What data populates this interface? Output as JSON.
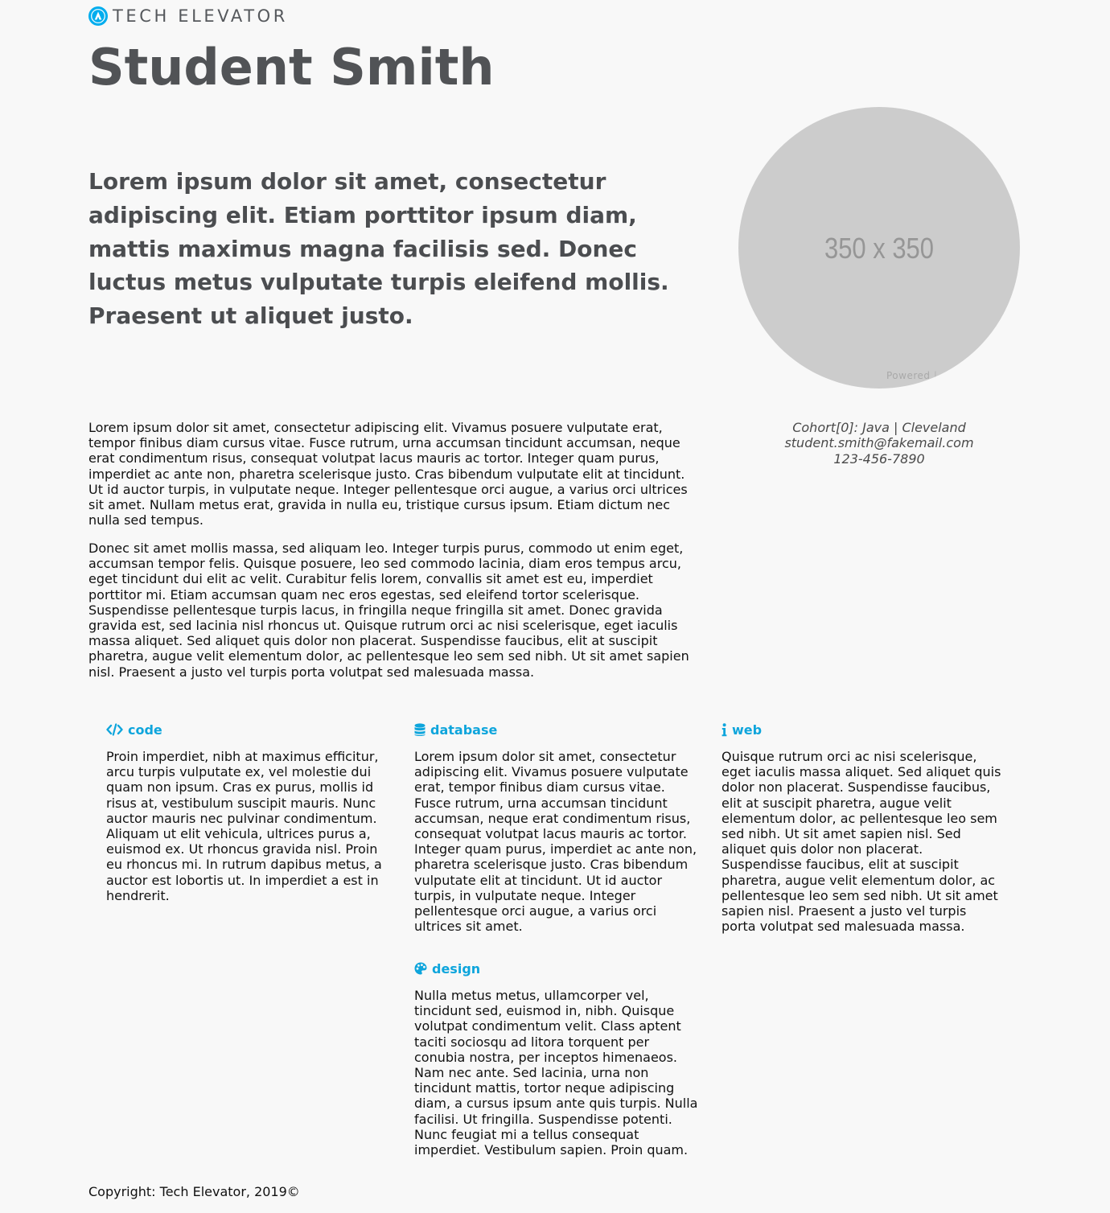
{
  "brand": {
    "logo_text": "TECH ELEVATOR",
    "logo_icon": "tech-elevator-logo-icon",
    "accent_color": "#00adee"
  },
  "profile": {
    "name": "Student Smith",
    "lede": "Lorem ipsum dolor sit amet, consectetur adipiscing elit. Etiam porttitor ipsum diam, mattis maximus magna facilisis sed. Donec luctus metus vulputate turpis eleifend mollis. Praesent ut aliquet justo.",
    "avatar_placeholder": "350 x 350",
    "avatar_powered": "Powered",
    "cohort": "Cohort[0]: Java | Cleveland",
    "email": "student.smith@fakemail.com",
    "phone": "123-456-7890"
  },
  "bio": {
    "paragraphs": [
      "Lorem ipsum dolor sit amet, consectetur adipiscing elit. Vivamus posuere vulputate erat, tempor finibus diam cursus vitae. Fusce rutrum, urna accumsan tincidunt accumsan, neque erat condimentum risus, consequat volutpat lacus mauris ac tortor. Integer quam purus, imperdiet ac ante non, pharetra scelerisque justo. Cras bibendum vulputate elit at tincidunt. Ut id auctor turpis, in vulputate neque. Integer pellentesque orci augue, a varius orci ultrices sit amet. Nullam metus erat, gravida in nulla eu, tristique cursus ipsum. Etiam dictum nec nulla sed tempus.",
      "Donec sit amet mollis massa, sed aliquam leo. Integer turpis purus, commodo ut enim eget, accumsan tempor felis. Quisque posuere, leo sed commodo lacinia, diam eros tempus arcu, eget tincidunt dui elit ac velit. Curabitur felis lorem, convallis sit amet est eu, imperdiet porttitor mi. Etiam accumsan quam nec eros egestas, sed eleifend tortor scelerisque. Suspendisse pellentesque turpis lacus, in fringilla neque fringilla sit amet. Donec gravida gravida est, sed lacinia nisl rhoncus ut. Quisque rutrum orci ac nisi scelerisque, eget iaculis massa aliquet. Sed aliquet quis dolor non placerat. Suspendisse faucibus, elit at suscipit pharetra, augue velit elementum dolor, ac pellentesque leo sem sed nibh. Ut sit amet sapien nisl. Praesent a justo vel turpis porta volutpat sed malesuada massa."
    ]
  },
  "skills": {
    "code": {
      "icon": "code-icon",
      "title": "code",
      "text": "Proin imperdiet, nibh at maximus efficitur, arcu turpis vulputate ex, vel molestie dui quam non ipsum. Cras ex purus, mollis id risus at, vestibulum suscipit mauris. Nunc auctor mauris nec pulvinar condimentum. Aliquam ut elit vehicula, ultrices purus a, euismod ex. Ut rhoncus gravida nisl. Proin eu rhoncus mi. In rutrum dapibus metus, a auctor est lobortis ut. In imperdiet a est in hendrerit."
    },
    "database": {
      "icon": "database-icon",
      "title": "database",
      "text": "Lorem ipsum dolor sit amet, consectetur adipiscing elit. Vivamus posuere vulputate erat, tempor finibus diam cursus vitae. Fusce rutrum, urna accumsan tincidunt accumsan, neque erat condimentum risus, consequat volutpat lacus mauris ac tortor. Integer quam purus, imperdiet ac ante non, pharetra scelerisque justo. Cras bibendum vulputate elit at tincidunt. Ut id auctor turpis, in vulputate neque. Integer pellentesque orci augue, a varius orci ultrices sit amet."
    },
    "web": {
      "icon": "info-icon",
      "title": "web",
      "text": "Quisque rutrum orci ac nisi scelerisque, eget iaculis massa aliquet. Sed aliquet quis dolor non placerat. Suspendisse faucibus, elit at suscipit pharetra, augue velit elementum dolor, ac pellentesque leo sem sed nibh. Ut sit amet sapien nisl. Sed aliquet quis dolor non placerat. Suspendisse faucibus, elit at suscipit pharetra, augue velit elementum dolor, ac pellentesque leo sem sed nibh. Ut sit amet sapien nisl. Praesent a justo vel turpis porta volutpat sed malesuada massa."
    },
    "design": {
      "icon": "palette-icon",
      "title": "design",
      "text": "Nulla metus metus, ullamcorper vel, tincidunt sed, euismod in, nibh. Quisque volutpat condimentum velit. Class aptent taciti sociosqu ad litora torquent per conubia nostra, per inceptos himenaeos. Nam nec ante. Sed lacinia, urna non tincidunt mattis, tortor neque adipiscing diam, a cursus ipsum ante quis turpis. Nulla facilisi. Ut fringilla. Suspendisse potenti. Nunc feugiat mi a tellus consequat imperdiet. Vestibulum sapien. Proin quam."
    }
  },
  "footer": {
    "copyright": "Copyright: Tech Elevator, 2019©"
  }
}
